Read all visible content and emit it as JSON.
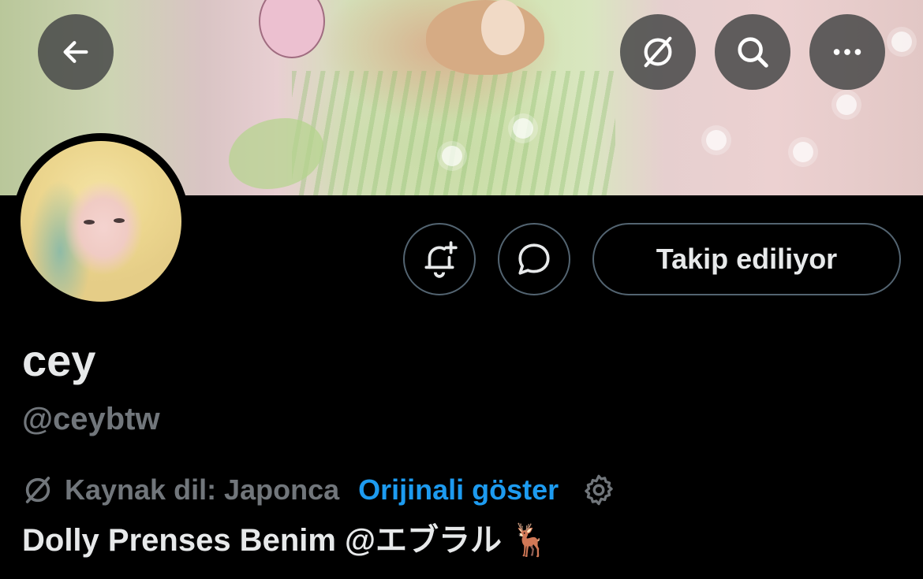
{
  "header": {
    "back_icon": "arrow-left-icon",
    "translate_icon": "translate-globe-icon",
    "search_icon": "search-icon",
    "more_icon": "more-horizontal-icon"
  },
  "actions": {
    "bell_icon": "bell-plus-icon",
    "message_icon": "message-bubble-icon",
    "follow_label": "Takip ediliyor"
  },
  "profile": {
    "display_name": "cey",
    "handle": "@ceybtw",
    "bio": "Dolly Prenses Benim @エブラル 🦌"
  },
  "translation": {
    "source_label": "Kaynak dil: Japonca",
    "show_original_label": "Orijinali göster",
    "settings_icon": "gear-icon"
  },
  "colors": {
    "background": "#000000",
    "primary_text": "#e7e9ea",
    "secondary_text": "#71767b",
    "link": "#1d9bf0",
    "border": "#536471"
  }
}
